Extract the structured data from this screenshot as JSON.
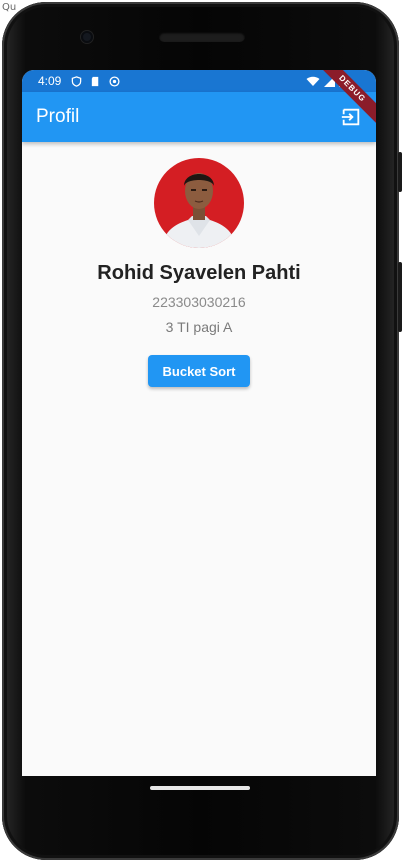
{
  "corner_text": "Qu",
  "status_bar": {
    "time": "4:09"
  },
  "app_bar": {
    "title": "Profil"
  },
  "debug_banner": "DEBUG",
  "profile": {
    "name": "Rohid Syavelen Pahti",
    "student_id": "223303030216",
    "class": "3 TI pagi A"
  },
  "actions": {
    "bucket_sort_label": "Bucket Sort"
  },
  "colors": {
    "primary": "#2196f3",
    "status_bar": "#1976d2",
    "avatar_bg": "#d41e23"
  }
}
